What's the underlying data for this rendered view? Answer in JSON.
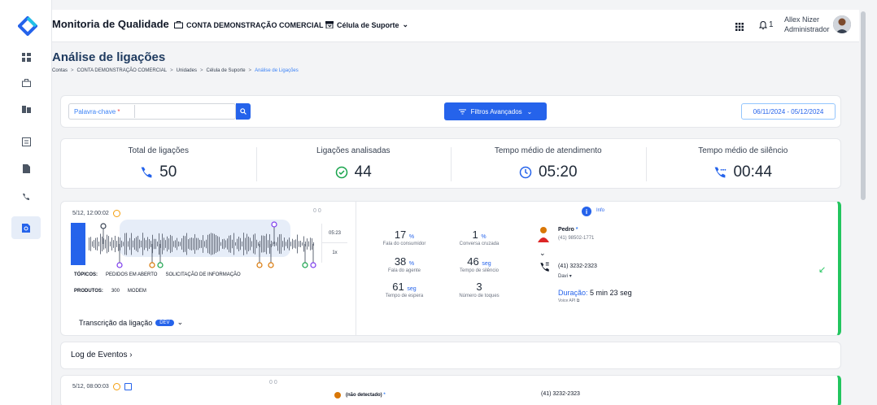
{
  "app": {
    "title": "Monitoria de Qualidade"
  },
  "topbar": {
    "account": "CONTA DEMONSTRAÇÃO COMERCIAL",
    "cell": "Célula de Suporte",
    "notifications": "1",
    "user_name": "Allex Nizer",
    "user_role": "Administrador"
  },
  "page": {
    "title": "Análise de ligações",
    "breadcrumb": [
      "Contas",
      "CONTA DEMONSTRAÇÃO COMERCIAL",
      "Unidades",
      "Célula de Suporte",
      "Análise de Ligações"
    ]
  },
  "filters": {
    "keyword_placeholder": "Palavra-chave",
    "advanced_label": "Filtros Avançados",
    "date_range": "06/11/2024 - 05/12/2024"
  },
  "stats": [
    {
      "label": "Total de ligações",
      "value": "50",
      "icon": "phone-icon"
    },
    {
      "label": "Ligações analisadas",
      "value": "44",
      "icon": "check-circle-icon"
    },
    {
      "label": "Tempo médio de atendimento",
      "value": "05:20",
      "icon": "clock-icon"
    },
    {
      "label": "Tempo médio de silêncio",
      "value": "00:44",
      "icon": "phone-silence-icon"
    }
  ],
  "calls": [
    {
      "datetime": "5/12, 12:00:02",
      "counts": "0  0",
      "durations": [
        "05:23",
        "1x"
      ],
      "topics_label": "TÓPICOS:",
      "topics": [
        "PEDIDOS EM ABERTO",
        "SOLICITAÇÃO DE INFORMAÇÃO"
      ],
      "products_label": "PRODUTOS:",
      "products": [
        "300",
        "MODEM"
      ],
      "transcription_label": "Transcrição da ligação",
      "transcription_badge": "DEV",
      "metrics": [
        {
          "value": "17",
          "unit": "%",
          "label": "Fala do consumidor"
        },
        {
          "value": "1",
          "unit": "%",
          "label": "Conversa cruzada"
        },
        {
          "value": "38",
          "unit": "%",
          "label": "Fala do agente"
        },
        {
          "value": "46",
          "unit": "seg",
          "label": "Tempo de silêncio"
        },
        {
          "value": "61",
          "unit": "seg",
          "label": "Tempo de espera"
        },
        {
          "value": "3",
          "unit": "",
          "label": "Número de toques"
        }
      ],
      "info_label": "Info",
      "customer_name": "Pedro",
      "customer_phone": "(41) 98502-1771",
      "call_number": "(41) 3232-2323",
      "agent": "Davi",
      "duration_label": "Duração:",
      "duration_value": "5 min 23 seg",
      "source": "Voice API"
    },
    {
      "datetime": "5/12, 08:00:03",
      "counts": "0  0",
      "customer_name": "(não detectado)",
      "call_number": "(41) 3232-2323"
    }
  ],
  "log": {
    "label": "Log de Eventos"
  },
  "colors": {
    "accent": "#2563eb",
    "success": "#22c55e",
    "brand": "#1e3a5f"
  }
}
